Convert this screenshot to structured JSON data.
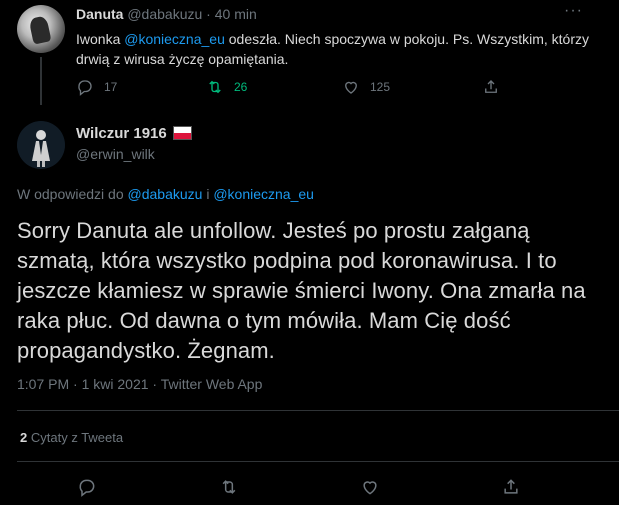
{
  "tweet1": {
    "display_name": "Danuta",
    "handle": "@dabakuzu",
    "dot": "·",
    "time": "40 min",
    "more": "···",
    "text_prefix": "Iwonka ",
    "mention": "@konieczna_eu",
    "text_suffix": "  odeszła. Niech spoczywa w pokoju.  Ps.  Wszystkim, którzy drwią z wirusa życzę opamiętania.",
    "replies": "17",
    "retweets": "26",
    "likes": "125"
  },
  "tweet2": {
    "display_name": "Wilczur 1916",
    "handle": "@erwin_wilk",
    "reply_prefix": "W odpowiedzi do ",
    "reply_mention1": "@dabakuzu",
    "reply_and": " i ",
    "reply_mention2": "@konieczna_eu",
    "text": "Sorry Danuta ale unfollow. Jesteś po prostu załganą szmatą, która wszystko podpina pod koronawirusa. I to jeszcze kłamiesz w sprawie śmierci Iwony. Ona zmarła na raka płuc. Od dawna o tym mówiła. Mam Cię dość propagandystko. Żegnam.",
    "meta": "1:07 PM · 1 kwi 2021 · Twitter Web App",
    "quote_count": "2",
    "quote_label": "Cytaty z Tweeta"
  },
  "colors": {
    "background": "#000000",
    "link": "#1d9bf0",
    "retweet_active": "#00ba7c",
    "muted": "#6e767d",
    "divider": "#2f3336",
    "flag_white": "#ffffff",
    "flag_red": "#dc143c"
  },
  "icons": [
    "reply-icon",
    "retweet-icon",
    "like-icon",
    "share-icon",
    "more-icon",
    "poland-flag-icon"
  ]
}
